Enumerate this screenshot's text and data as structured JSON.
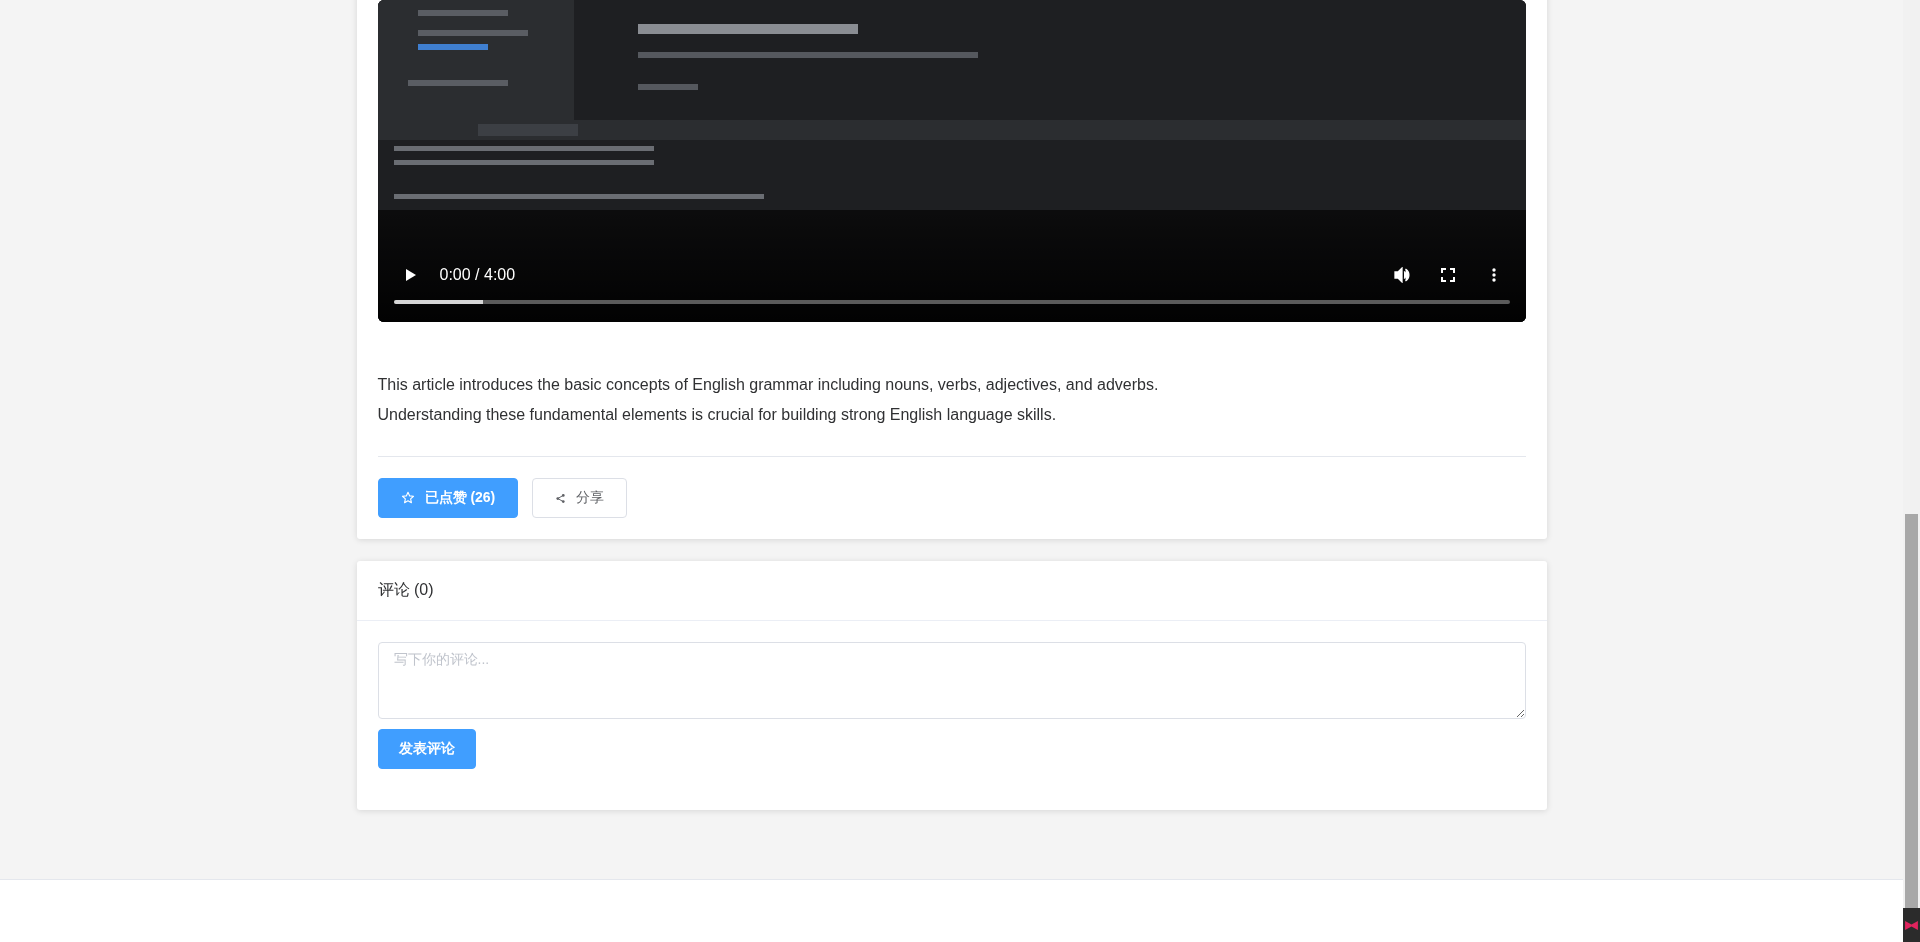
{
  "video": {
    "time": "0:00 / 4:00",
    "progress": {
      "level": 0.08
    }
  },
  "article": {
    "paragraphs": [
      "This article introduces the basic concepts of English grammar including nouns, verbs, adjectives, and adverbs.",
      "Understanding these fundamental elements is crucial for building strong English language skills."
    ]
  },
  "actions": {
    "like": {
      "label": "已点赞 (26)",
      "liked": true
    },
    "share": {
      "label": "分享"
    }
  },
  "comments": {
    "title": "评论 (0)",
    "input": {
      "placeholder": "写下你的评论..."
    },
    "submit": "发表评论"
  }
}
